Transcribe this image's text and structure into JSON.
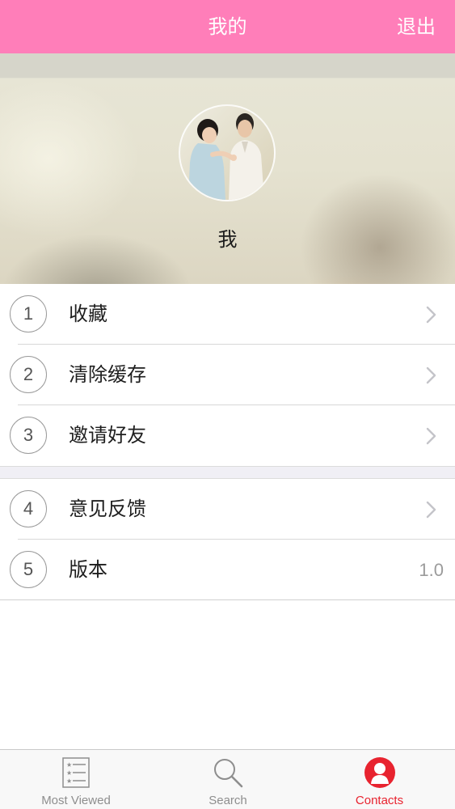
{
  "header": {
    "title": "我的",
    "logout_label": "退出",
    "background_color": "#ff7eb9"
  },
  "profile": {
    "name": "我",
    "avatar_icon": "user-avatar-photo"
  },
  "menu": {
    "group1": [
      {
        "index": "1",
        "label": "收藏",
        "icon": "chevron-right-icon"
      },
      {
        "index": "2",
        "label": "清除缓存",
        "icon": "chevron-right-icon"
      },
      {
        "index": "3",
        "label": "邀请好友",
        "icon": "chevron-right-icon"
      }
    ],
    "group2": [
      {
        "index": "4",
        "label": "意见反馈",
        "icon": "chevron-right-icon"
      },
      {
        "index": "5",
        "label": "版本",
        "value": "1.0"
      }
    ]
  },
  "tabbar": {
    "active_color": "#e8232f",
    "items": [
      {
        "label": "Most Viewed",
        "icon": "list-icon"
      },
      {
        "label": "Search",
        "icon": "search-icon"
      },
      {
        "label": "Contacts",
        "icon": "contacts-icon",
        "active": true
      }
    ]
  }
}
